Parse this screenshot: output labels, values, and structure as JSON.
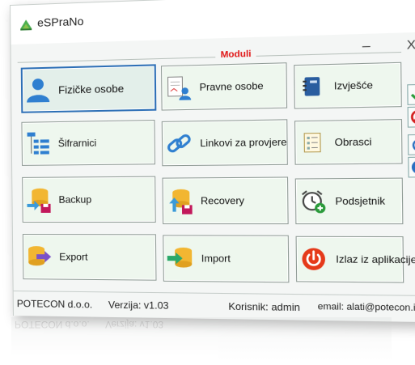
{
  "window": {
    "title": "eSPraNo",
    "minimize": "–",
    "close": "X"
  },
  "group": {
    "label": "Moduli"
  },
  "tiles": [
    {
      "label": "Fizičke osobe",
      "icon": "person-icon"
    },
    {
      "label": "Pravne osobe",
      "icon": "legal-entity-icon"
    },
    {
      "label": "Izvješće",
      "icon": "notebook-icon"
    },
    {
      "label": "Šifrarnici",
      "icon": "hierarchy-list-icon"
    },
    {
      "label": "Linkovi za provjere",
      "icon": "chain-link-icon"
    },
    {
      "label": "Obrasci",
      "icon": "form-icon"
    },
    {
      "label": "Backup",
      "icon": "database-backup-icon"
    },
    {
      "label": "Recovery",
      "icon": "database-recovery-icon"
    },
    {
      "label": "Podsjetnik",
      "icon": "alarm-clock-icon"
    },
    {
      "label": "Export",
      "icon": "database-export-icon"
    },
    {
      "label": "Import",
      "icon": "database-import-icon"
    },
    {
      "label": "Izlaz iz aplikacije",
      "icon": "power-icon"
    }
  ],
  "side_buttons": [
    {
      "name": "confirm",
      "icon": "check-icon"
    },
    {
      "name": "cancel",
      "icon": "cancel-icon"
    },
    {
      "name": "refresh",
      "icon": "refresh-icon"
    },
    {
      "name": "help",
      "icon": "help-icon"
    }
  ],
  "status": {
    "company": "POTECON d.o.o.",
    "version": "Verzija: v1.03",
    "user": "Korisnik: admin",
    "email": "email: alati@potecon.info"
  },
  "colors": {
    "accent_red": "#e01515",
    "selected_border": "#2d6fb6",
    "tile_bg": "#eef7ee",
    "check_green": "#2a9a3a"
  }
}
